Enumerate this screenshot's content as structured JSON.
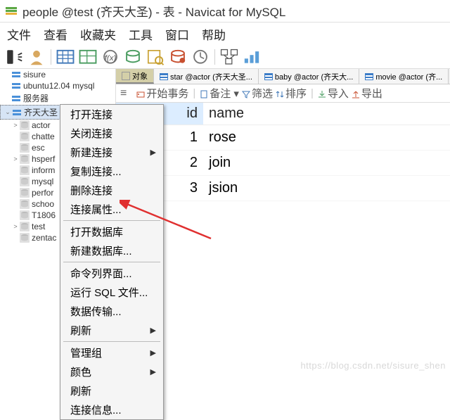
{
  "titlebar": {
    "title": "people @test (齐天大圣) - 表 - Navicat for MySQL"
  },
  "menubar": [
    "文件",
    "查看",
    "收藏夹",
    "工具",
    "窗口",
    "帮助"
  ],
  "sidebar": {
    "items": [
      {
        "label": "sisure",
        "type": "srv"
      },
      {
        "label": "ubuntu12.04 mysql",
        "type": "srv"
      },
      {
        "label": "服务器",
        "type": "srv"
      },
      {
        "label": "齐天大圣",
        "type": "srv",
        "selected": true,
        "expanded": true
      },
      {
        "label": "actor",
        "type": "db",
        "depth": 1,
        "expander": ">"
      },
      {
        "label": "chatte",
        "type": "db",
        "depth": 1
      },
      {
        "label": "esc",
        "type": "db",
        "depth": 1
      },
      {
        "label": "hsperf",
        "type": "db",
        "depth": 1,
        "expander": ">"
      },
      {
        "label": "inform",
        "type": "db",
        "depth": 1
      },
      {
        "label": "mysql",
        "type": "db",
        "depth": 1
      },
      {
        "label": "perfor",
        "type": "db",
        "depth": 1
      },
      {
        "label": "schoo",
        "type": "db",
        "depth": 1
      },
      {
        "label": "T1806",
        "type": "db",
        "depth": 1
      },
      {
        "label": "test",
        "type": "db",
        "depth": 1,
        "expander": ">"
      },
      {
        "label": "zentac",
        "type": "db",
        "depth": 1
      }
    ]
  },
  "tabs": [
    {
      "label": "对象",
      "active": true,
      "icon": "obj"
    },
    {
      "label": "star @actor (齐天大圣...",
      "icon": "tbl"
    },
    {
      "label": "baby @actor (齐天大...",
      "icon": "tbl"
    },
    {
      "label": "movie @actor (齐...",
      "icon": "tbl"
    }
  ],
  "actionbar": {
    "start": "开始事务",
    "note": "备注 ▾",
    "filter": "筛选",
    "sort": "排序",
    "import": "导入",
    "export": "导出"
  },
  "grid": {
    "headers": [
      "id",
      "name"
    ],
    "rows": [
      {
        "id": "1",
        "name": "rose"
      },
      {
        "id": "2",
        "name": "join"
      },
      {
        "id": "3",
        "name": "jsion"
      }
    ]
  },
  "contextmenu": {
    "groups": [
      [
        {
          "label": "打开连接"
        },
        {
          "label": "关闭连接"
        },
        {
          "label": "新建连接",
          "sub": true
        },
        {
          "label": "复制连接..."
        },
        {
          "label": "删除连接"
        },
        {
          "label": "连接属性..."
        }
      ],
      [
        {
          "label": "打开数据库"
        },
        {
          "label": "新建数据库..."
        }
      ],
      [
        {
          "label": "命令列界面..."
        },
        {
          "label": "运行 SQL 文件..."
        },
        {
          "label": "数据传输..."
        },
        {
          "label": "刷新",
          "sub": true
        }
      ],
      [
        {
          "label": "管理组",
          "sub": true
        },
        {
          "label": "颜色",
          "sub": true
        },
        {
          "label": "刷新"
        },
        {
          "label": "连接信息..."
        }
      ]
    ]
  },
  "watermark": "https://blog.csdn.net/sisure_shen"
}
